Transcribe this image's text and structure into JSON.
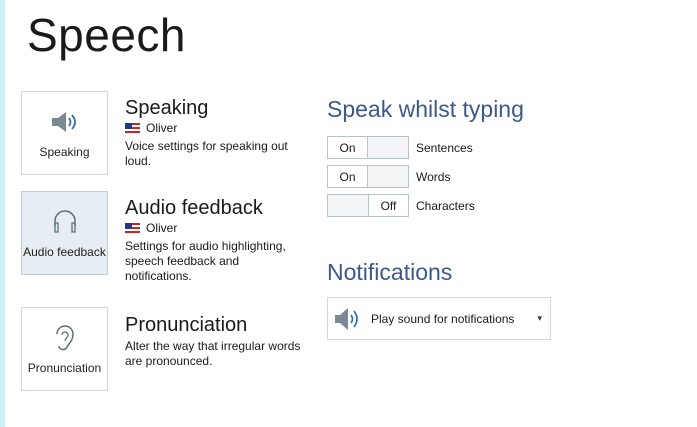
{
  "page": {
    "title": "Speech"
  },
  "options": [
    {
      "tile_label": "Speaking",
      "title": "Speaking",
      "voice": "Oliver",
      "description": "Voice settings for speaking out loud."
    },
    {
      "tile_label": "Audio feedback",
      "title": "Audio feedback",
      "voice": "Oliver",
      "description": "Settings for audio highlighting, speech feedback and notifications."
    },
    {
      "tile_label": "Pronunciation",
      "title": "Pronunciation",
      "description": "Alter the way that irregular words are pronounced."
    }
  ],
  "speak_whilst_typing": {
    "heading": "Speak whilst typing",
    "toggles": [
      {
        "label": "Sentences",
        "state": "On"
      },
      {
        "label": "Words",
        "state": "On"
      },
      {
        "label": "Characters",
        "state": "Off"
      }
    ]
  },
  "notifications": {
    "heading": "Notifications",
    "selected": "Play sound for notifications",
    "icon": "speaker-icon"
  },
  "colors": {
    "window_border": "#cdf2f8",
    "heading_blue": "#3d5a87",
    "selected_tile": "#e6eef3",
    "speaker_gray": "#7a8a93"
  }
}
